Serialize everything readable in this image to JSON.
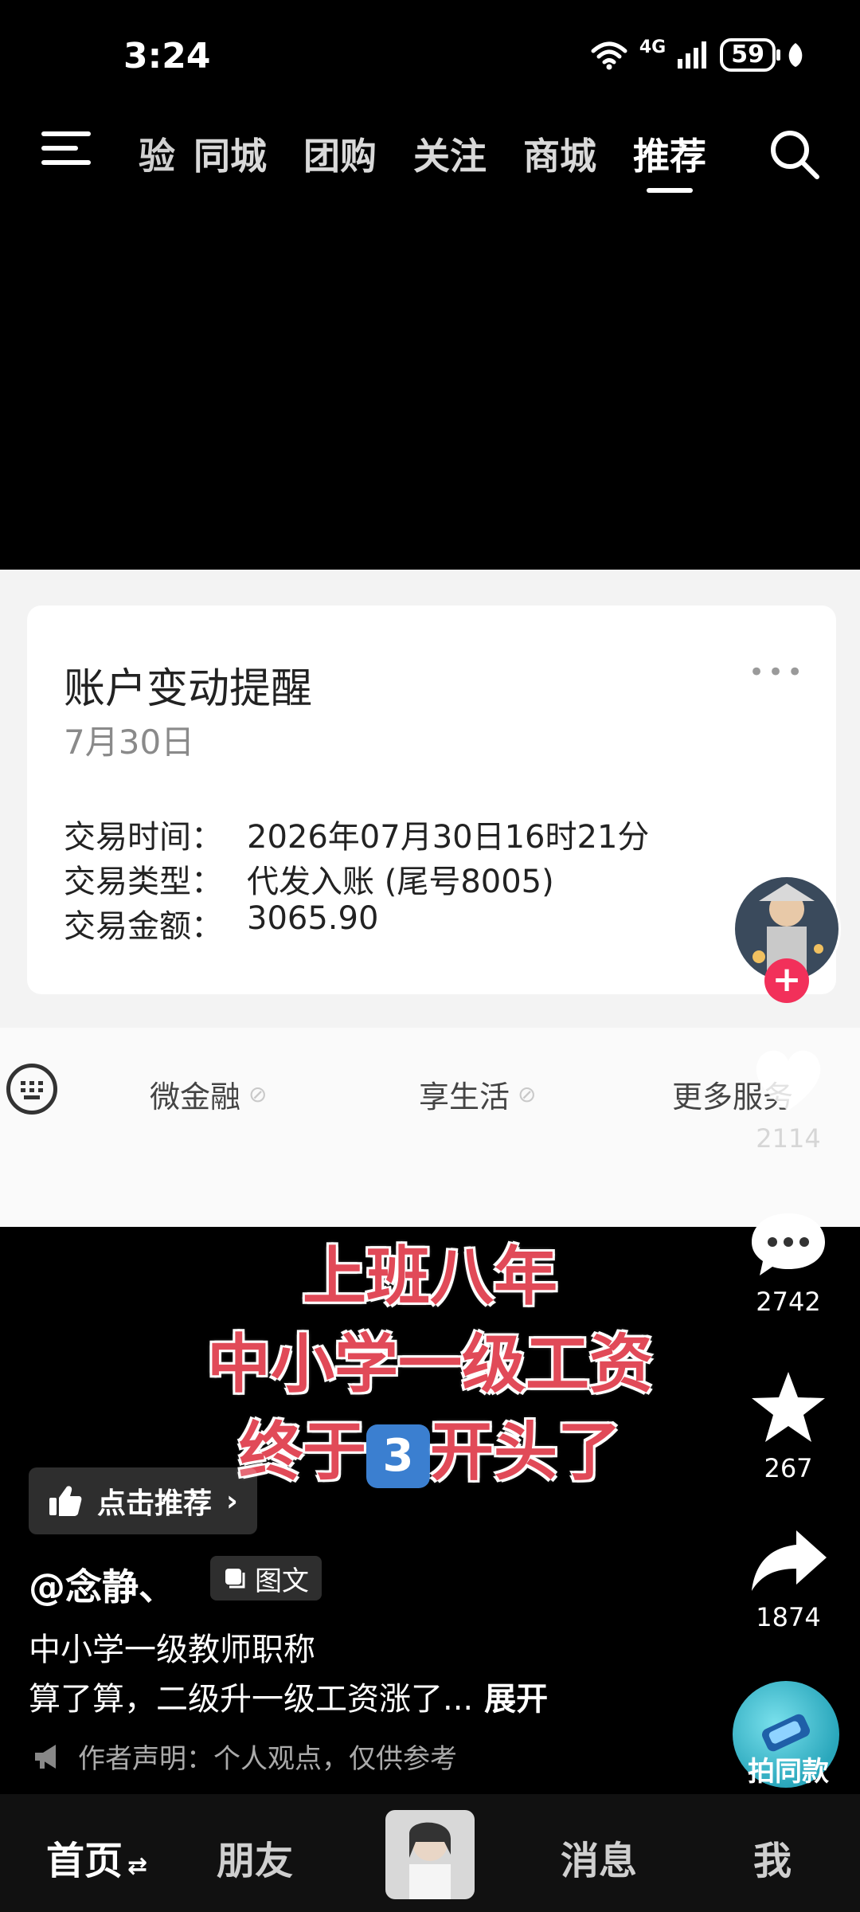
{
  "status": {
    "time": "3:24",
    "network": "4G",
    "battery": "59"
  },
  "tabs": [
    "验",
    "同城",
    "团购",
    "关注",
    "商城",
    "推荐"
  ],
  "post_image": {
    "title": "账户变动提醒",
    "date": "7月30日",
    "rows": [
      {
        "key": "交易时间：",
        "value": "2026年07月30日16时21分"
      },
      {
        "key": "交易类型：",
        "value": "代发入账 (尾号8005)"
      },
      {
        "key": "交易金额：",
        "value": "3065.90"
      }
    ],
    "services": [
      "微金融",
      "享生活",
      "更多服务"
    ]
  },
  "overlay": {
    "line1": "上班八年",
    "line2": "中小学一级工资",
    "line3_pre": "终于",
    "line3_key": "3",
    "line3_post": "开头了"
  },
  "rail": {
    "likes": "2114",
    "comments": "2742",
    "favorites": "267",
    "shares": "1874",
    "same_label": "拍同款"
  },
  "info": {
    "recommend": "点击推荐",
    "author": "@念静、",
    "tag": "图文",
    "desc1": "中小学一级教师职称",
    "desc2": "算了算，二级升一级工资涨了...",
    "expand": "展开",
    "notice": "作者声明：个人观点，仅供参考"
  },
  "nav": {
    "home": "首页",
    "friends": "朋友",
    "messages": "消息",
    "me": "我"
  }
}
